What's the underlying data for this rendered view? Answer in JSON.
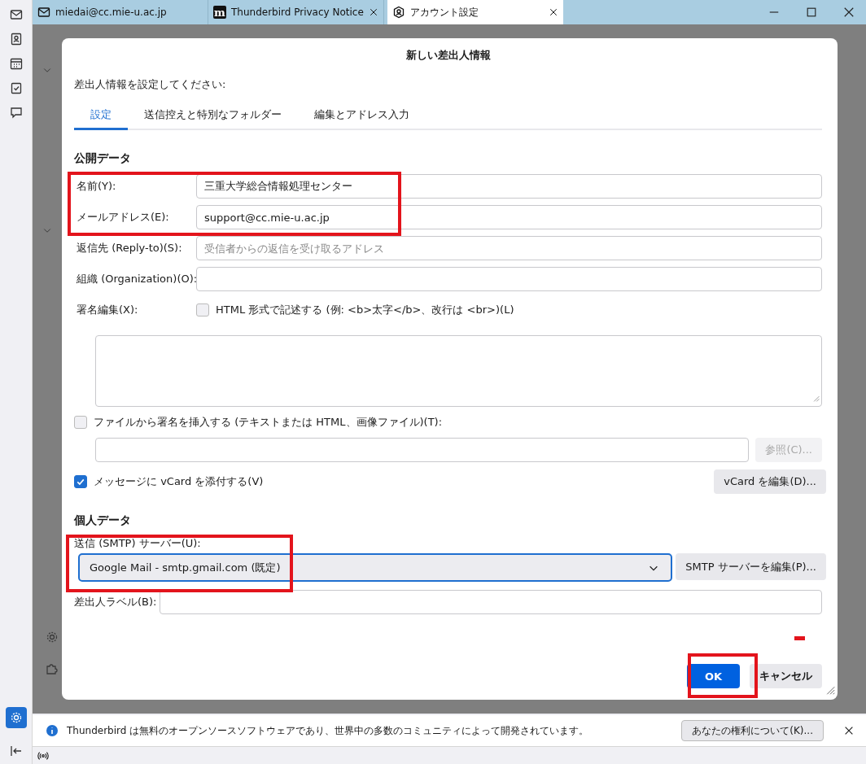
{
  "app_tabs": [
    {
      "kind": "mail",
      "label": "miedai@cc.mie-u.ac.jp",
      "selected": false,
      "closable": false
    },
    {
      "kind": "web",
      "logo": "m",
      "label": "Thunderbird Privacy Notice",
      "selected": false,
      "closable": true
    },
    {
      "kind": "account",
      "label": "アカウント設定",
      "selected": true,
      "closable": true
    }
  ],
  "dialog": {
    "title": "新しい差出人情報",
    "prompt": "差出人情報を設定してください:",
    "tabs": [
      {
        "label": "設定",
        "selected": true
      },
      {
        "label": "送信控えと特別なフォルダー",
        "selected": false
      },
      {
        "label": "編集とアドレス入力",
        "selected": false
      }
    ],
    "public_heading": "公開データ",
    "fields": [
      {
        "label": "名前(Y):",
        "value": "三重大学総合情報処理センター"
      },
      {
        "label": "メールアドレス(E):",
        "value": "support@cc.mie-u.ac.jp"
      },
      {
        "label": "返信先 (Reply-to)(S):",
        "placeholder": "受信者からの返信を受け取るアドレス"
      },
      {
        "label": "組織 (Organization)(O):"
      }
    ],
    "signature": {
      "label": "署名編集(X):",
      "html_checkbox": {
        "label": "HTML 形式で記述する (例: <b>太字</b>、改行は <br>)(L)",
        "checked": false
      }
    },
    "signature_file": {
      "label": "ファイルから署名を挿入する (テキストまたは HTML、画像ファイル)(T):",
      "checked": false,
      "browse_button": {
        "label": "参照(C)...",
        "disabled": true
      }
    },
    "vcard": {
      "label": "メッセージに vCard を添付する(V)",
      "checked": true,
      "edit_button": {
        "label": "vCard を編集(D)...",
        "disabled": false
      }
    },
    "private_heading": "個人データ",
    "smtp": {
      "label": "送信 (SMTP) サーバー(U):",
      "value": "Google Mail - smtp.gmail.com (既定)",
      "edit_button": "SMTP サーバーを編集(P)..."
    },
    "identity_label": {
      "label": "差出人ラベル(B):"
    },
    "ok_button": "OK",
    "cancel_button": "キャンセル"
  },
  "notification": {
    "text": "Thunderbird は無料のオープンソースソフトウェアであり、世界中の多数のコミュニティによって開発されています。",
    "button": "あなたの権利について(K)..."
  }
}
